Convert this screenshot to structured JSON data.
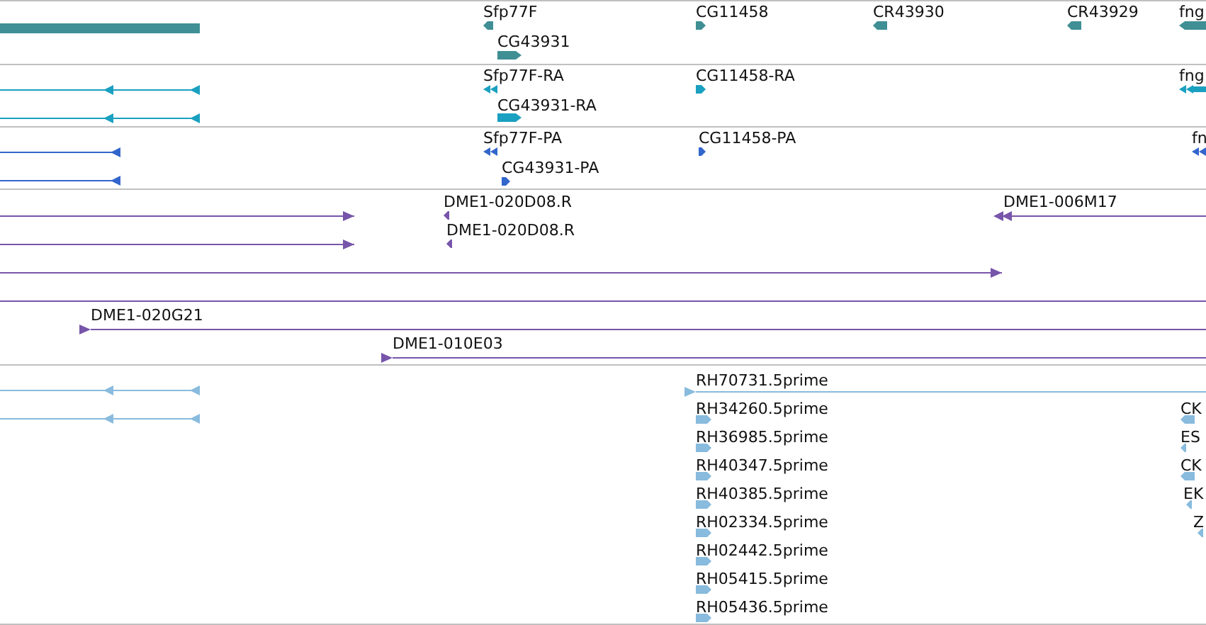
{
  "tracks": [
    {
      "color": "#3f8f94",
      "labels": [
        "Sfp77F",
        "CG43931",
        "CG11458",
        "CR43930",
        "CR43929",
        "fng"
      ]
    },
    {
      "color": "#1aa0c0",
      "labels": [
        "Sfp77F-RA",
        "CG43931-RA",
        "CG11458-RA",
        "fng"
      ]
    },
    {
      "color": "#3366cc",
      "labels": [
        "Sfp77F-PA",
        "CG43931-PA",
        "CG11458-PA",
        "fn"
      ]
    },
    {
      "color": "#7755aa",
      "labels": [
        "DME1-020D08.R",
        "DME1-020D08.R",
        "DME1-006M17",
        "DME1-020G21",
        "DME1-010E03"
      ]
    },
    {
      "color": "#88bbdd",
      "labels": [
        "RH70731.5prime",
        "RH34260.5prime",
        "RH36985.5prime",
        "RH40347.5prime",
        "RH40385.5prime",
        "RH02334.5prime",
        "RH02442.5prime",
        "RH05415.5prime",
        "RH05436.5prime",
        "CK",
        "ES",
        "CK",
        "EK",
        "Z"
      ]
    }
  ]
}
